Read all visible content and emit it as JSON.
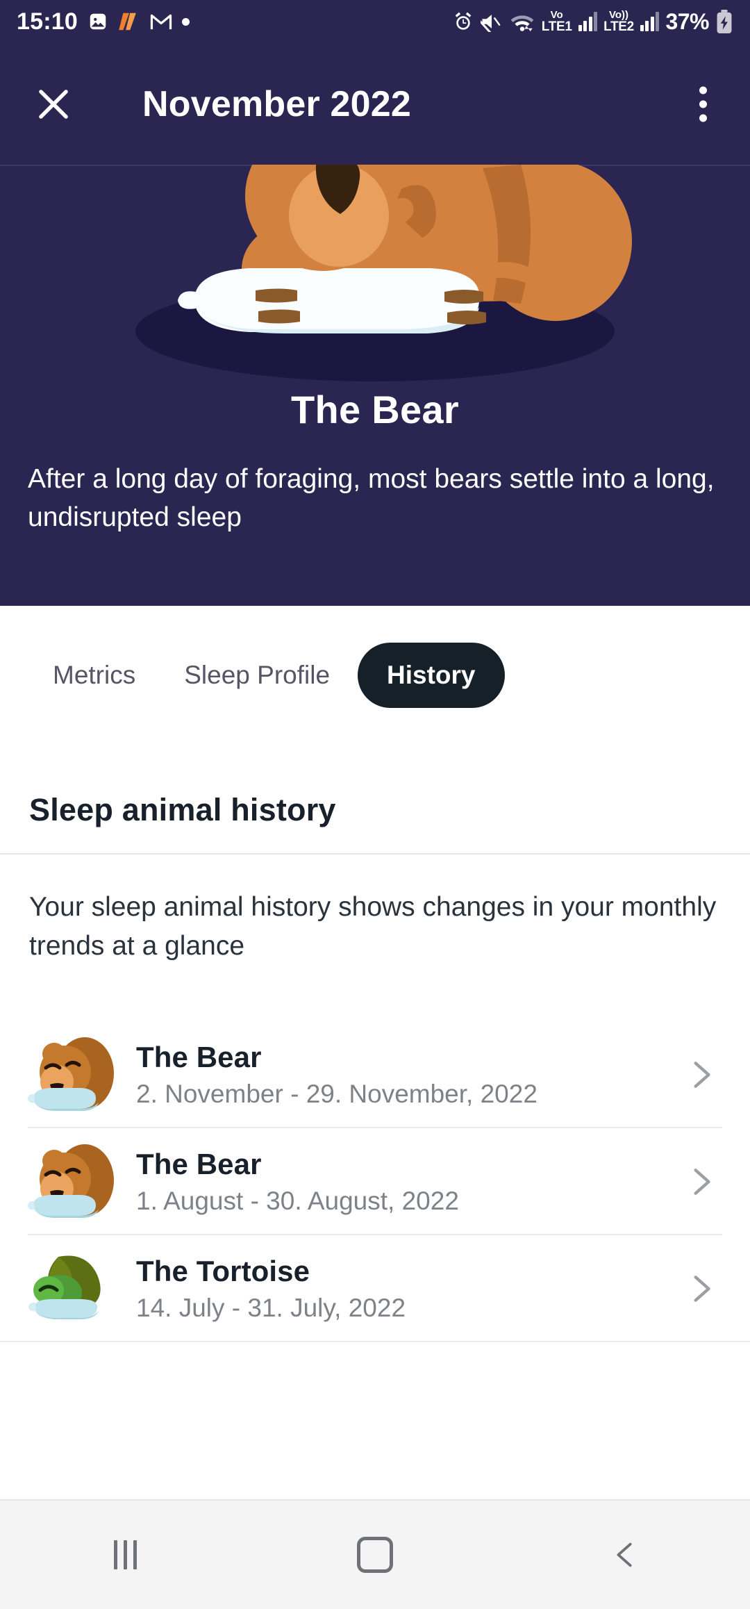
{
  "status_bar": {
    "time": "15:10",
    "left_icons": [
      "photo-icon",
      "heart-activity-icon",
      "gmail-icon",
      "dot-icon"
    ],
    "right_icons": [
      "alarm-icon",
      "mute-icon",
      "wifi-icon"
    ],
    "network1_top": "Vo",
    "network1_bottom": "LTE1",
    "network2_top": "Vo))",
    "network2_bottom": "LTE2",
    "battery_percent": "37%",
    "battery_state": "charging"
  },
  "app_bar": {
    "close_label": "close-icon",
    "title": "November 2022",
    "menu_label": "overflow-menu-icon"
  },
  "hero": {
    "illustration": "sleeping-bear-illustration",
    "title": "The Bear",
    "description": "After a long day of foraging, most bears settle into a long, undisrupted sleep",
    "background_color": "#2B2552"
  },
  "tabs": [
    {
      "label": "Metrics",
      "active": false
    },
    {
      "label": "Sleep Profile",
      "active": false
    },
    {
      "label": "History",
      "active": true
    }
  ],
  "section": {
    "title": "Sleep animal history",
    "description": "Your sleep animal history shows changes in your monthly trends at a glance"
  },
  "history": [
    {
      "icon": "bear-icon",
      "title": "The Bear",
      "date_range": "2. November - 29. November, 2022"
    },
    {
      "icon": "bear-icon",
      "title": "The Bear",
      "date_range": "1. August - 30. August, 2022"
    },
    {
      "icon": "tortoise-icon",
      "title": "The Tortoise",
      "date_range": "14. July - 31. July, 2022"
    }
  ],
  "nav_bar": {
    "recents": "recents-icon",
    "home": "home-icon",
    "back": "back-icon"
  },
  "colors": {
    "header_bg": "#2B2552",
    "active_tab_bg": "#162029",
    "text_primary": "#18202b",
    "text_muted": "#7c8288",
    "bear_body": "#D2813F",
    "bear_head": "#E8A05C",
    "tortoise_shell": "#5C6F12",
    "tortoise_body": "#5EA23C"
  }
}
